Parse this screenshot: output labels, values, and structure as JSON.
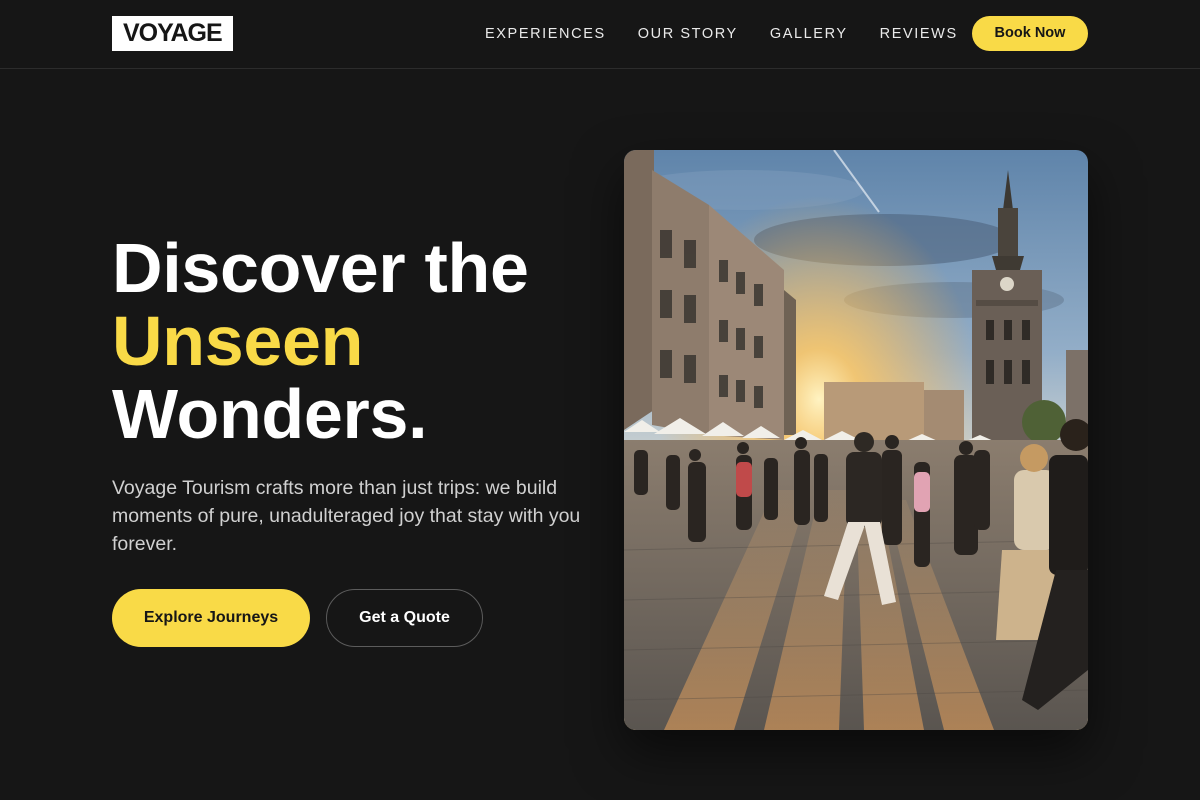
{
  "brand": {
    "name": "VOYAGE"
  },
  "nav": {
    "links": [
      "EXPERIENCES",
      "OUR STORY",
      "GALLERY",
      "REVIEWS"
    ],
    "cta": "Book Now"
  },
  "hero": {
    "title_line1": "Discover the",
    "title_highlight": "Unseen",
    "title_line3": "Wonders.",
    "description": "Voyage Tourism crafts more than just trips: we build moments of pure, unadulteraged joy that stay with you forever.",
    "primary_cta": "Explore Journeys",
    "secondary_cta": "Get a Quote"
  },
  "colors": {
    "background": "#161616",
    "accent": "#f9da47",
    "text": "#ffffff",
    "muted_text": "#d0d0d0"
  }
}
